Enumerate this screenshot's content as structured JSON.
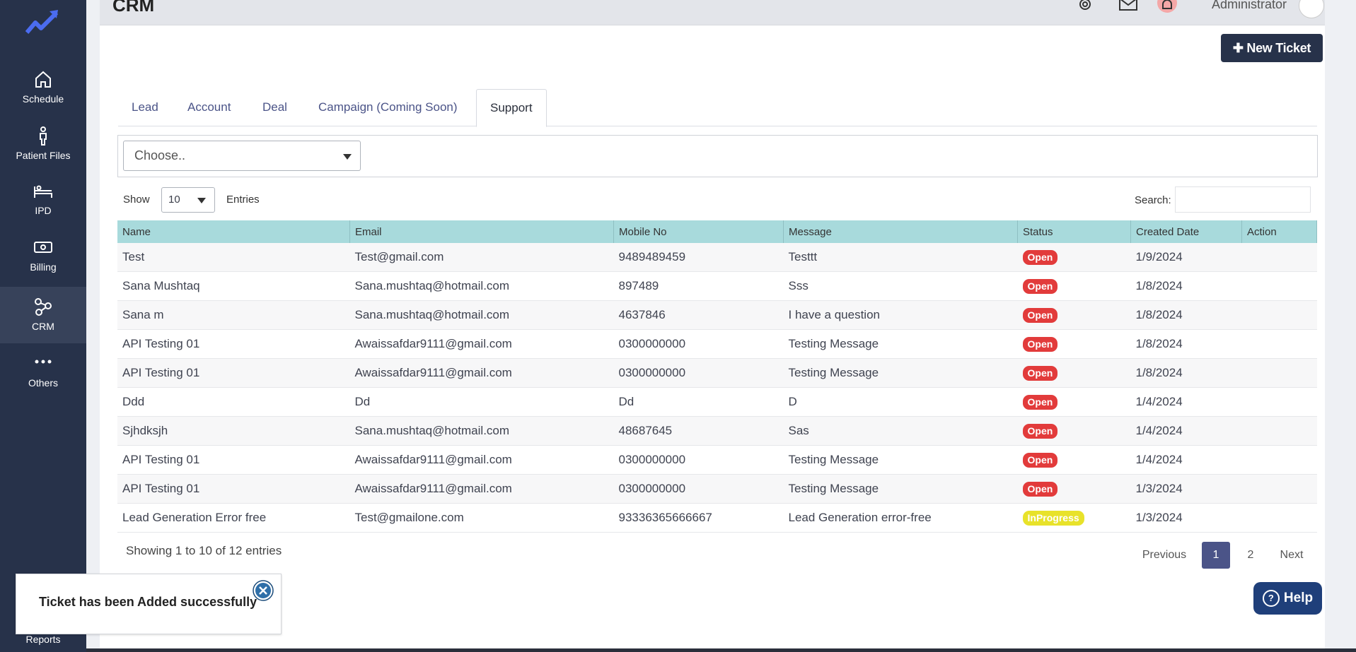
{
  "sidebar": {
    "items": [
      {
        "label": "Schedule",
        "icon": "home-icon"
      },
      {
        "label": "Patient Files",
        "icon": "person-icon"
      },
      {
        "label": "IPD",
        "icon": "bed-icon"
      },
      {
        "label": "Billing",
        "icon": "money-icon"
      },
      {
        "label": "CRM",
        "icon": "crm-icon"
      },
      {
        "label": "Others",
        "icon": "more-icon"
      }
    ],
    "reports_label": "Reports"
  },
  "header": {
    "title": "CRM",
    "user_name": "Administrator"
  },
  "toolbar": {
    "new_ticket_label": "New Ticket"
  },
  "tabs": [
    {
      "label": "Lead"
    },
    {
      "label": "Account"
    },
    {
      "label": "Deal"
    },
    {
      "label": "Campaign (Coming Soon)"
    },
    {
      "label": "Support",
      "active": true
    }
  ],
  "filter": {
    "selected": "Choose.."
  },
  "table_controls": {
    "show_label": "Show",
    "entries_value": "10",
    "entries_label": "Entries",
    "search_label": "Search:"
  },
  "table": {
    "columns": [
      "Name",
      "Email",
      "Mobile No",
      "Message",
      "Status",
      "Created Date",
      "Action"
    ],
    "rows": [
      {
        "name": "Test",
        "email": "Test@gmail.com",
        "mobile": "9489489459",
        "message": "Testtt",
        "status": "Open",
        "date": "1/9/2024"
      },
      {
        "name": "Sana Mushtaq",
        "email": "Sana.mushtaq@hotmail.com",
        "mobile": "897489",
        "message": "Sss",
        "status": "Open",
        "date": "1/8/2024"
      },
      {
        "name": "Sana m",
        "email": "Sana.mushtaq@hotmail.com",
        "mobile": "4637846",
        "message": "I have a question",
        "status": "Open",
        "date": "1/8/2024"
      },
      {
        "name": "API Testing 01",
        "email": "Awaissafdar9111@gmail.com",
        "mobile": "0300000000",
        "message": "Testing Message",
        "status": "Open",
        "date": "1/8/2024"
      },
      {
        "name": "API Testing 01",
        "email": "Awaissafdar9111@gmail.com",
        "mobile": "0300000000",
        "message": "Testing Message",
        "status": "Open",
        "date": "1/8/2024"
      },
      {
        "name": "Ddd",
        "email": "Dd",
        "mobile": "Dd",
        "message": "D",
        "status": "Open",
        "date": "1/4/2024"
      },
      {
        "name": "Sjhdksjh",
        "email": "Sana.mushtaq@hotmail.com",
        "mobile": "48687645",
        "message": "Sas",
        "status": "Open",
        "date": "1/4/2024"
      },
      {
        "name": "API Testing 01",
        "email": "Awaissafdar9111@gmail.com",
        "mobile": "0300000000",
        "message": "Testing Message",
        "status": "Open",
        "date": "1/4/2024"
      },
      {
        "name": "API Testing 01",
        "email": "Awaissafdar9111@gmail.com",
        "mobile": "0300000000",
        "message": "Testing Message",
        "status": "Open",
        "date": "1/3/2024"
      },
      {
        "name": "Lead Generation Error free",
        "email": "Test@gmailone.com",
        "mobile": "93336365666667",
        "message": "Lead Generation error-free",
        "status": "InProgress",
        "date": "1/3/2024"
      }
    ]
  },
  "pagination": {
    "summary": "Showing 1 to 10 of 12 entries",
    "previous": "Previous",
    "pages": [
      "1",
      "2"
    ],
    "current": "1",
    "next": "Next"
  },
  "toast": {
    "message": "Ticket has been Added successfully"
  },
  "help": {
    "label": "Help"
  },
  "colors": {
    "sidebar": "#27324a",
    "table_header": "#a8dadc",
    "status_open": "#e23b3b",
    "status_inprogress": "#e8e22a",
    "accent": "#4b5488"
  }
}
